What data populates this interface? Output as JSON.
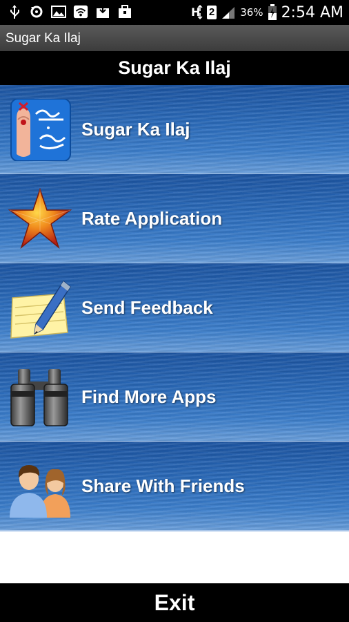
{
  "status_bar": {
    "battery_percent": "36%",
    "sim_slot": "2",
    "time": "2:54 AM",
    "icons": [
      "usb-icon",
      "sync-icon",
      "image-icon",
      "wifi-icon",
      "download-icon",
      "briefcase-icon",
      "signal-icon",
      "battery-icon"
    ]
  },
  "window_title": "Sugar Ka Ilaj",
  "header_title": "Sugar Ka Ilaj",
  "menu": {
    "items": [
      {
        "label": "Sugar Ka Ilaj",
        "icon": "sugar-app-icon"
      },
      {
        "label": "Rate Application",
        "icon": "star-icon"
      },
      {
        "label": "Send Feedback",
        "icon": "note-pencil-icon"
      },
      {
        "label": "Find More Apps",
        "icon": "binoculars-icon"
      },
      {
        "label": "Share With Friends",
        "icon": "people-icon"
      }
    ]
  },
  "exit_label": "Exit",
  "colors": {
    "menu_blue": "#2b6cbc",
    "bar_black": "#000000"
  }
}
